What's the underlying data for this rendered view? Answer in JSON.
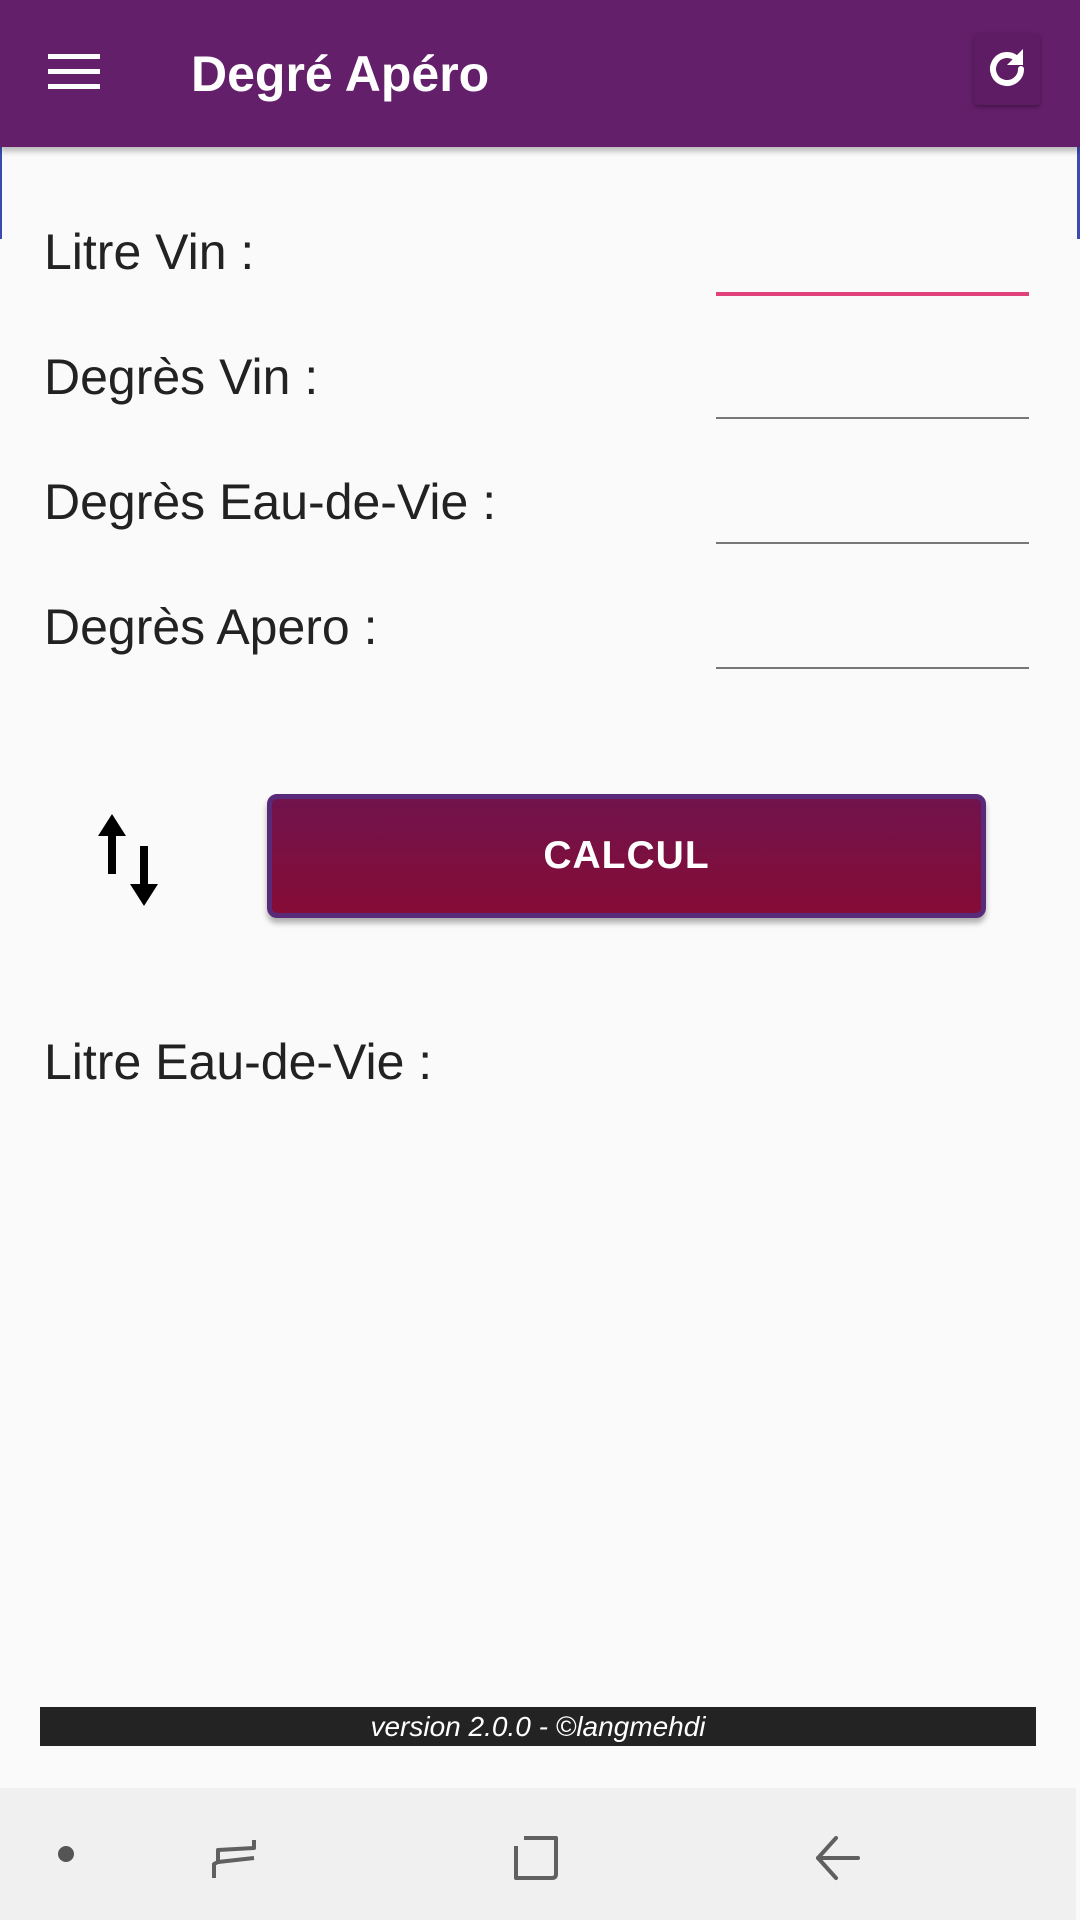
{
  "appbar": {
    "title": "Degré Apéro",
    "background": "#641f6b",
    "menu_icon": "hamburger-menu-icon",
    "refresh_icon": "refresh-icon"
  },
  "form": {
    "litre_vin_label": "Litre Vin :",
    "litre_vin_value": "",
    "degres_vin_label": "Degrès Vin :",
    "degres_vin_value": "",
    "degres_eau_de_vie_label": "Degrès Eau-de-Vie :",
    "degres_eau_de_vie_value": "",
    "degres_apero_label": "Degrès Apero :",
    "degres_apero_value": "",
    "focused_underline_color": "#e0417a"
  },
  "actions": {
    "swap_icon": "swap-vertical-icon",
    "calcul_label": "CALCUL",
    "calcul_color": "#850c35"
  },
  "result": {
    "label": "Litre Eau-de-Vie :",
    "value": ""
  },
  "footer": {
    "version_text": "version 2.0.0 - ©langmehdi"
  },
  "navbar": {
    "dot_icon": "dot-icon",
    "recents_icon": "recent-apps-icon",
    "home_icon": "home-square-icon",
    "back_icon": "back-arrow-icon"
  }
}
